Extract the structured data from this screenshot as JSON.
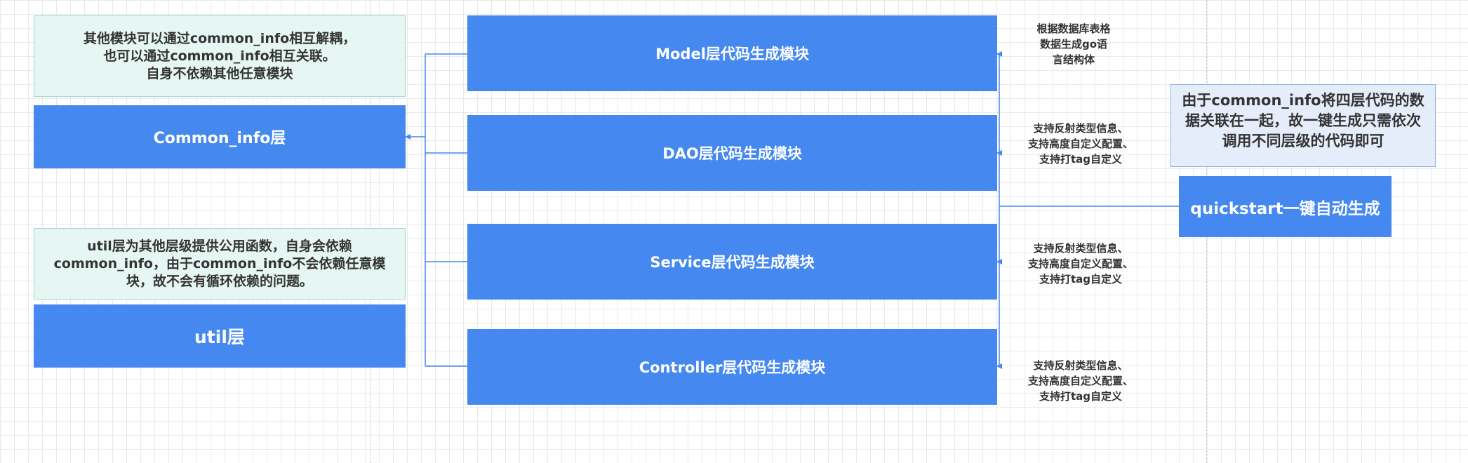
{
  "diagram": {
    "left": {
      "common_info_note": {
        "lines": [
          "其他模块可以通过common_info相互解耦，",
          "也可以通过common_info相互关联。",
          "自身不依赖其他任意模块"
        ]
      },
      "common_info_box": {
        "label": "Common_info层"
      },
      "util_note": {
        "lines": [
          "util层为其他层级提供公用函数，自身会依赖",
          "common_info，由于common_info不会依赖任意模",
          "块，故不会有循环依赖的问题。"
        ]
      },
      "util_box": {
        "label": "util层"
      }
    },
    "modules": [
      {
        "label": "Model层代码生成模块",
        "annotation": [
          "根据数据库表格",
          "数据生成go语",
          "言结构体"
        ]
      },
      {
        "label": "DAO层代码生成模块",
        "annotation": [
          "支持反射类型信息、",
          "支持高度自定义配置、",
          "支持打tag自定义"
        ]
      },
      {
        "label": "Service层代码生成模块",
        "annotation": [
          "支持反射类型信息、",
          "支持高度自定义配置、",
          "支持打tag自定义"
        ]
      },
      {
        "label": "Controller层代码生成模块",
        "annotation": [
          "支持反射类型信息、",
          "支持高度自定义配置、",
          "支持打tag自定义"
        ]
      }
    ],
    "right": {
      "quickstart_note": {
        "lines": [
          "由于common_info将四层代码的数",
          "据关联在一起，故一键生成只需依次",
          "调用不同层级的代码即可"
        ]
      },
      "quickstart_box": {
        "label": "quickstart一键自动生成"
      }
    },
    "colors": {
      "box_blue": "#4589f0",
      "note_green_bg": "#e6f7f3",
      "note_blue_bg": "#e5edfb",
      "connector": "#4589f0"
    }
  }
}
